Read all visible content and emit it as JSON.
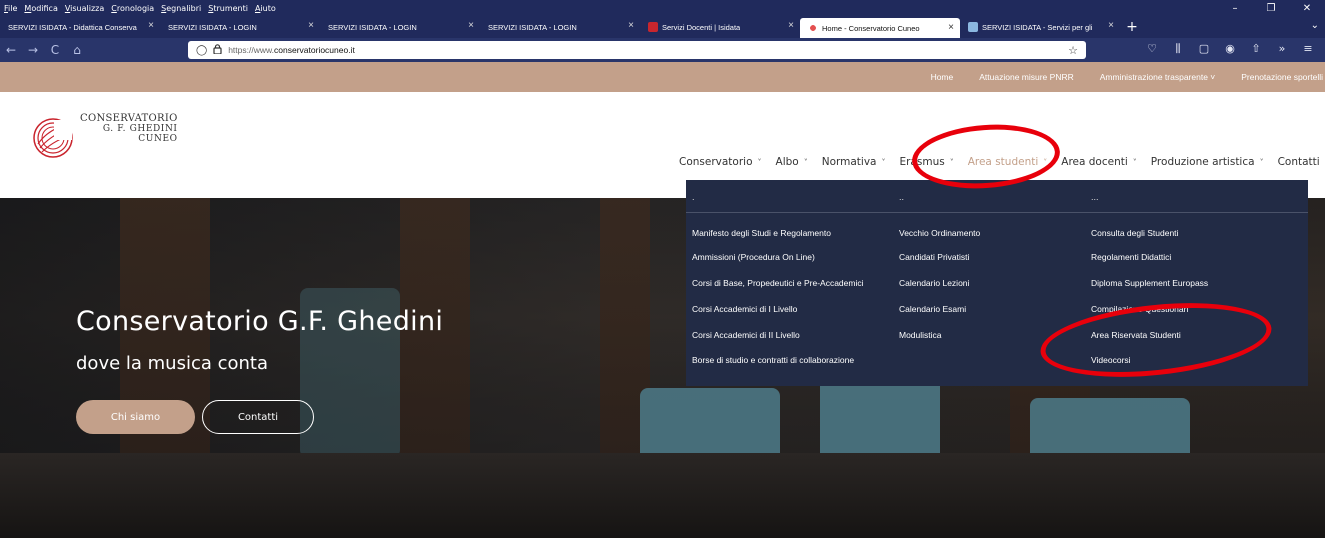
{
  "menubar": {
    "items": [
      "File",
      "Modifica",
      "Visualizza",
      "Cronologia",
      "Segnalibri",
      "Strumenti",
      "Aiuto"
    ]
  },
  "window_controls": {
    "minimize": "–",
    "maximize": "❐",
    "close": "✕"
  },
  "tabs": [
    {
      "label": "SERVIZI ISIDATA - Didattica Conserva",
      "favicon": "none",
      "active": false
    },
    {
      "label": "SERVIZI ISIDATA - LOGIN",
      "favicon": "none",
      "active": false
    },
    {
      "label": "SERVIZI ISIDATA - LOGIN",
      "favicon": "none",
      "active": false
    },
    {
      "label": "SERVIZI ISIDATA - LOGIN",
      "favicon": "none",
      "active": false
    },
    {
      "label": "Servizi Docenti | Isidata",
      "favicon": "isidata-icon",
      "active": false
    },
    {
      "label": "Home - Conservatorio Cuneo",
      "favicon": "conservatorio-icon",
      "active": true
    },
    {
      "label": "SERVIZI ISIDATA - Servizi per gli",
      "favicon": "isidata-icon",
      "active": false
    }
  ],
  "tab_close": "×",
  "new_tab": "+",
  "tab_overflow": "⌄",
  "nav": {
    "back": "←",
    "forward": "→",
    "reload": "C",
    "home": "⌂"
  },
  "url": {
    "prefix": "https://www.",
    "domain": "conservatoriocuneo.it",
    "shield": "◯",
    "lock": "🔒",
    "star": "☆"
  },
  "toolbar_icons": [
    "♡",
    "⫼",
    "▢",
    "◉",
    "⇧",
    "»",
    "≡"
  ],
  "topbar": [
    "Home",
    "Attuazione misure PNRR",
    "Amministrazione trasparente ˅",
    "Prenotazione sportelli"
  ],
  "logo": {
    "line1": "CONSERVATORIO",
    "line2": "G. F. GHEDINI",
    "line3": "CUNEO"
  },
  "mainnav": [
    {
      "label": "Conservatorio",
      "active": false
    },
    {
      "label": "Albo",
      "active": false
    },
    {
      "label": "Normativa",
      "active": false
    },
    {
      "label": "Erasmus",
      "active": false
    },
    {
      "label": "Area studenti",
      "active": true
    },
    {
      "label": "Area docenti",
      "active": false
    },
    {
      "label": "Produzione artistica",
      "active": false
    },
    {
      "label": "Contatti",
      "active": false
    }
  ],
  "chevron": "˅",
  "hero": {
    "title": "Conservatorio G.F. Ghedini",
    "subtitle": "dove la musica conta",
    "btn_primary": "Chi siamo",
    "btn_secondary": "Contatti"
  },
  "dropdown": {
    "headers": [
      ".",
      "..",
      "..."
    ],
    "columns": [
      [
        "Manifesto degli Studi e Regolamento",
        "Ammissioni (Procedura On Line)",
        "Corsi di Base, Propedeutici e Pre-Accademici",
        "Corsi Accademici di I Livello",
        "Corsi Accademici di II Livello",
        "Borse di studio e contratti di collaborazione"
      ],
      [
        "Vecchio Ordinamento",
        "Candidati Privatisti",
        "Calendario Lezioni",
        "Calendario Esami",
        "Modulistica"
      ],
      [
        "Consulta degli Studenti",
        "Regolamenti Didattici",
        "Diploma Supplement Europass",
        "Compilazione Questionari",
        "Area Riservata Studenti",
        "Videocorsi"
      ]
    ]
  },
  "colors": {
    "browser_dark": "#202a5c",
    "accent": "#c3a08a",
    "dropdown_bg": "#222b45",
    "annotation": "#e8000b"
  }
}
